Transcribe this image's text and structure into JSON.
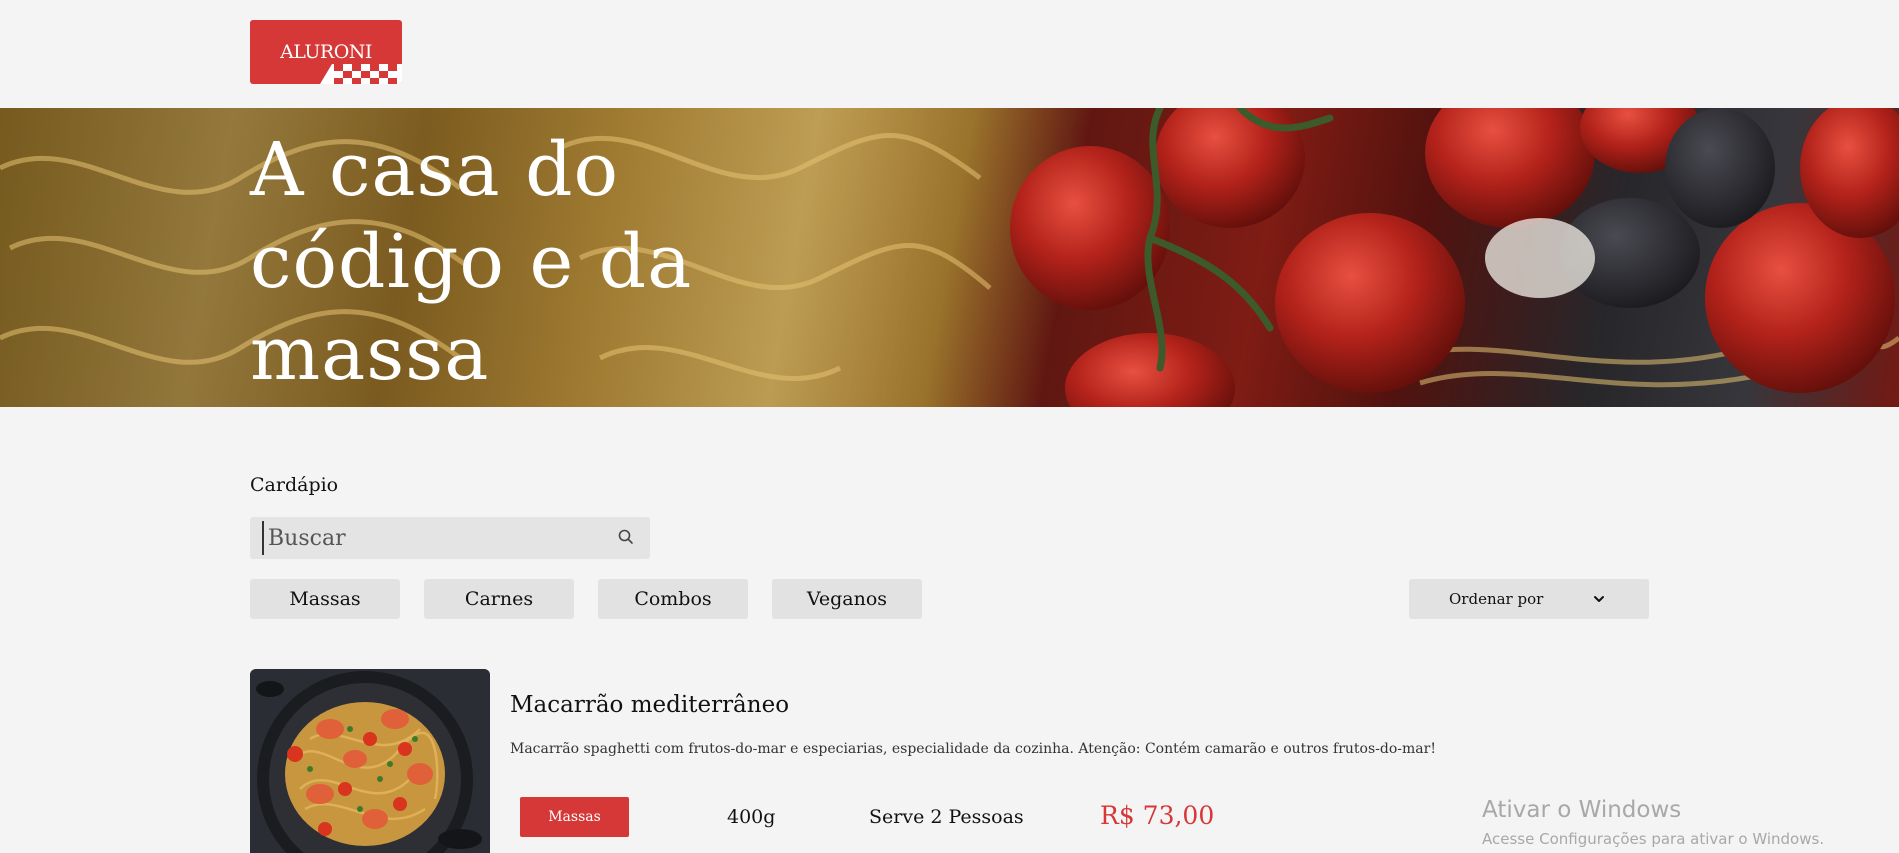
{
  "brand": {
    "logo_text": "ALURONI",
    "accent_color": "#d63838"
  },
  "hero": {
    "title_lines": [
      "A casa do",
      "código e da",
      "massa"
    ]
  },
  "menu": {
    "label": "Cardápio",
    "search": {
      "placeholder": "Buscar",
      "value": ""
    },
    "filters": [
      "Massas",
      "Carnes",
      "Combos",
      "Veganos"
    ],
    "sort": {
      "label": "Ordenar por"
    }
  },
  "items": [
    {
      "title": "Macarrão mediterrâneo",
      "description": "Macarrão spaghetti com frutos-do-mar e especiarias, especialidade da cozinha. Atenção: Contém camarão e outros frutos-do-mar!",
      "category": "Massas",
      "size": "400g",
      "serves": "Serve 2 Pessoas",
      "price": "R$ 73,00"
    }
  ],
  "windows_watermark": {
    "title": "Ativar o Windows",
    "subtitle": "Acesse Configurações para ativar o Windows."
  },
  "icons": {
    "search": "search-icon",
    "sort": "chevron-down-icon"
  }
}
